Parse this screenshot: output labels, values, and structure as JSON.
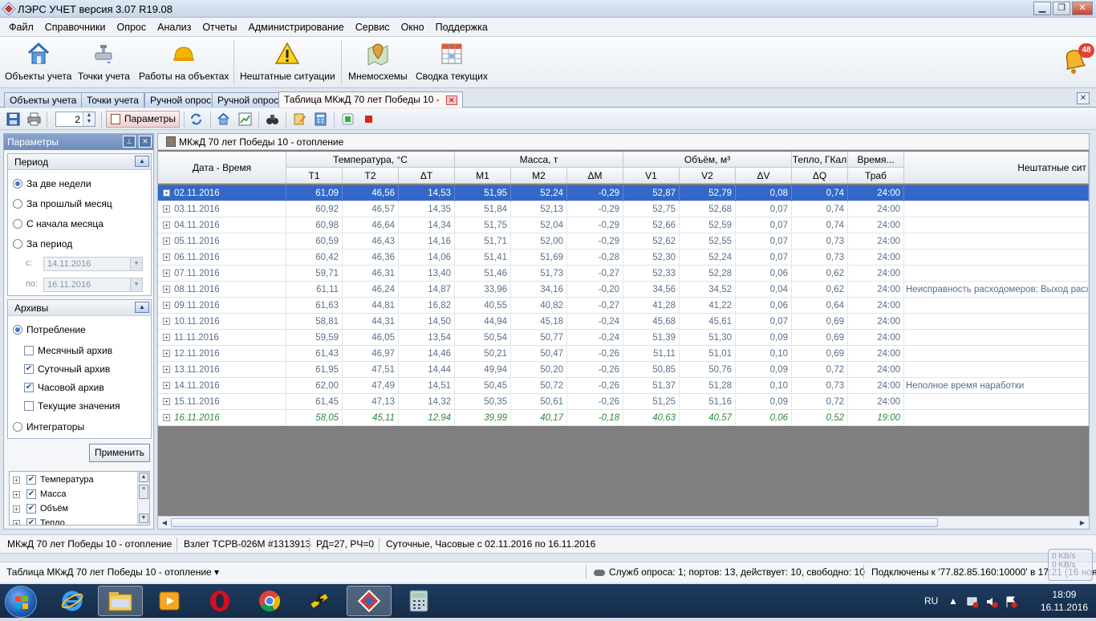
{
  "window": {
    "title": "ЛЭРС УЧЕТ версия 3.07 R19.08"
  },
  "menu": [
    "Файл",
    "Справочники",
    "Опрос",
    "Анализ",
    "Отчеты",
    "Администрирование",
    "Сервис",
    "Окно",
    "Поддержка"
  ],
  "ribbon": {
    "objects": "Объекты учета",
    "points": "Точки учета",
    "works": "Работы на объектах",
    "emergency": "Нештатные ситуации",
    "mnemo": "Мнемосхемы",
    "summary": "Сводка текущих",
    "notifications": "48"
  },
  "tabs": [
    "Объекты учета",
    "Точки учета",
    "Ручной опрос",
    "Ручной опрос",
    "Таблица МКжД 70 лет Победы 10 -"
  ],
  "toolbar": {
    "spin_value": "2",
    "params_label": "Параметры"
  },
  "params": {
    "title": "Параметры",
    "period_title": "Период",
    "period_options": [
      "За две недели",
      "За прошлый месяц",
      "С начала месяца",
      "За период"
    ],
    "from_label": "с:",
    "to_label": "по:",
    "from_date": "14.11.2016",
    "to_date": "16.11.2016",
    "archives_title": "Архивы",
    "consumption": "Потребление",
    "archive_options": [
      {
        "label": "Месячный архив",
        "checked": false
      },
      {
        "label": "Суточный архив",
        "checked": true
      },
      {
        "label": "Часовой архив",
        "checked": true
      },
      {
        "label": "Текущие значения",
        "checked": false
      }
    ],
    "integrators": "Интеграторы",
    "apply": "Применить",
    "tree": [
      "Температура",
      "Масса",
      "Объём",
      "Тепло"
    ]
  },
  "table": {
    "title": "МКжД 70 лет Победы 10 - отопление",
    "date_header": "Дата - Время",
    "groups": [
      "Температура, °С",
      "Масса, т",
      "Объём, м³",
      "Тепло, ГКал",
      "Время..."
    ],
    "columns": [
      "T1",
      "T2",
      "ΔT",
      "M1",
      "M2",
      "ΔM",
      "V1",
      "V2",
      "ΔV",
      "ΔQ",
      "Траб"
    ],
    "emergency_header": "Нештатные сит",
    "rows": [
      [
        "02.11.2016",
        "61,09",
        "46,56",
        "14,53",
        "51,95",
        "52,24",
        "-0,29",
        "52,87",
        "52,79",
        "0,08",
        "0,74",
        "24:00",
        ""
      ],
      [
        "03.11.2016",
        "60,92",
        "46,57",
        "14,35",
        "51,84",
        "52,13",
        "-0,29",
        "52,75",
        "52,68",
        "0,07",
        "0,74",
        "24:00",
        ""
      ],
      [
        "04.11.2016",
        "60,98",
        "46,64",
        "14,34",
        "51,75",
        "52,04",
        "-0,29",
        "52,66",
        "52,59",
        "0,07",
        "0,74",
        "24:00",
        ""
      ],
      [
        "05.11.2016",
        "60,59",
        "46,43",
        "14,16",
        "51,71",
        "52,00",
        "-0,29",
        "52,62",
        "52,55",
        "0,07",
        "0,73",
        "24:00",
        ""
      ],
      [
        "06.11.2016",
        "60,42",
        "46,36",
        "14,06",
        "51,41",
        "51,69",
        "-0,28",
        "52,30",
        "52,24",
        "0,07",
        "0,73",
        "24:00",
        ""
      ],
      [
        "07.11.2016",
        "59,71",
        "46,31",
        "13,40",
        "51,46",
        "51,73",
        "-0,27",
        "52,33",
        "52,28",
        "0,06",
        "0,62",
        "24:00",
        ""
      ],
      [
        "08.11.2016",
        "61,11",
        "46,24",
        "14,87",
        "33,96",
        "34,16",
        "-0,20",
        "34,56",
        "34,52",
        "0,04",
        "0,62",
        "24:00",
        "Неисправность расходомеров; Выход расхо,"
      ],
      [
        "09.11.2016",
        "61,63",
        "44,81",
        "16,82",
        "40,55",
        "40,82",
        "-0,27",
        "41,28",
        "41,22",
        "0,06",
        "0,64",
        "24:00",
        ""
      ],
      [
        "10.11.2016",
        "58,81",
        "44,31",
        "14,50",
        "44,94",
        "45,18",
        "-0,24",
        "45,68",
        "45,61",
        "0,07",
        "0,69",
        "24:00",
        ""
      ],
      [
        "11.11.2016",
        "59,59",
        "46,05",
        "13,54",
        "50,54",
        "50,77",
        "-0,24",
        "51,39",
        "51,30",
        "0,09",
        "0,69",
        "24:00",
        ""
      ],
      [
        "12.11.2016",
        "61,43",
        "46,97",
        "14,46",
        "50,21",
        "50,47",
        "-0,26",
        "51,11",
        "51,01",
        "0,10",
        "0,69",
        "24:00",
        ""
      ],
      [
        "13.11.2016",
        "61,95",
        "47,51",
        "14,44",
        "49,94",
        "50,20",
        "-0,26",
        "50,85",
        "50,76",
        "0,09",
        "0,72",
        "24:00",
        ""
      ],
      [
        "14.11.2016",
        "62,00",
        "47,49",
        "14,51",
        "50,45",
        "50,72",
        "-0,26",
        "51,37",
        "51,28",
        "0,10",
        "0,73",
        "24:00",
        "Неполное время наработки"
      ],
      [
        "15.11.2016",
        "61,45",
        "47,13",
        "14,32",
        "50,35",
        "50,61",
        "-0,26",
        "51,25",
        "51,16",
        "0,09",
        "0,72",
        "24:00",
        ""
      ],
      [
        "16.11.2016",
        "58,05",
        "45,11",
        "12,94",
        "39,99",
        "40,17",
        "-0,18",
        "40,63",
        "40,57",
        "0,06",
        "0,52",
        "19:00",
        ""
      ]
    ]
  },
  "status": {
    "object": "МКжД 70 лет Победы 10 - отопление",
    "device": "Взлет ТСРВ-026М #1313913",
    "rd": "РД=27, РЧ=0",
    "archive": "Суточные, Часовые с 02.11.2016 по 16.11.2016",
    "window_name": "Таблица МКжД 70 лет Победы 10 - отопление",
    "services": "Служб опроса: 1; портов: 13, действует: 10, свободно: 10",
    "connected": "Подключены к '77.82.85.160:10000' в 17:21 (16 нояб",
    "speed1": "0 KB/s",
    "speed2": "0 KB/s"
  },
  "taskbar": {
    "lang": "RU",
    "time": "18:09",
    "date": "16.11.2016"
  }
}
